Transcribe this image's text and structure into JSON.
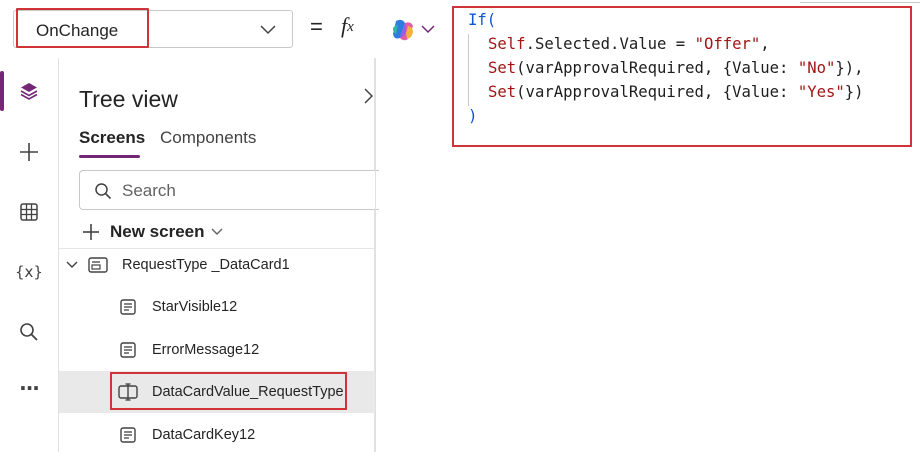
{
  "formula_bar": {
    "property": "OnChange",
    "equals": "=",
    "fx": "f",
    "fx_sub": "x"
  },
  "code": {
    "l1_kw": "If(",
    "l2_self": "Self",
    "l2_mid": ".Selected.Value = ",
    "l2_str": "\"Offer\"",
    "l2_end": ",",
    "l3_fn": "Set",
    "l3_mid": "(varApprovalRequired, {Value: ",
    "l3_str": "\"No\"",
    "l3_end": "}),",
    "l4_fn": "Set",
    "l4_mid": "(varApprovalRequired, {Value: ",
    "l4_str": "\"Yes\"",
    "l4_end": "})",
    "l5": ")"
  },
  "rail": {
    "icons": [
      "layers-icon",
      "plus-icon",
      "table-icon",
      "variables-icon",
      "search-icon",
      "more-icon"
    ],
    "variables_glyph": "{x}",
    "more_glyph": "···",
    "accent": "#742774"
  },
  "tree": {
    "title": "Tree view",
    "tabs": [
      "Screens",
      "Components"
    ],
    "search_placeholder": "Search",
    "new_screen": "New screen",
    "nodes": [
      "RequestType _DataCard1",
      "StarVisible12",
      "ErrorMessage12",
      "DataCardValue_RequestType",
      "DataCardKey12"
    ]
  },
  "colors": {
    "highlight": "#d13438",
    "keyword_blue": "#0f54d6",
    "string_red": "#a31515"
  }
}
